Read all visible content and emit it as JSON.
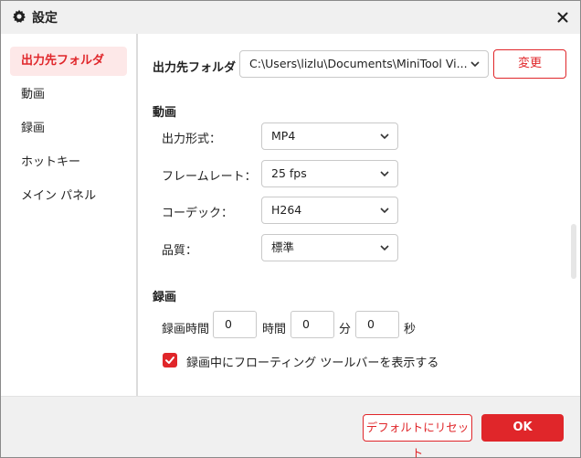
{
  "window": {
    "title": "設定",
    "icons": {
      "title": "gear-icon",
      "close": "close-icon"
    }
  },
  "sidebar": {
    "items": [
      {
        "label": "出力先フォルダ",
        "active": true
      },
      {
        "label": "動画",
        "active": false
      },
      {
        "label": "録画",
        "active": false
      },
      {
        "label": "ホットキー",
        "active": false
      },
      {
        "label": "メイン パネル",
        "active": false
      }
    ]
  },
  "output_folder": {
    "label": "出力先フォルダ",
    "path": "C:\\Users\\lizlu\\Documents\\MiniTool Vi...",
    "change_button": "変更"
  },
  "video": {
    "heading": "動画",
    "format_label": "出力形式：",
    "format_value": "MP4",
    "framerate_label": "フレームレート：",
    "framerate_value": "25 fps",
    "codec_label": "コーデック：",
    "codec_value": "H264",
    "quality_label": "品質：",
    "quality_value": "標準"
  },
  "recording": {
    "heading": "録画",
    "duration_label": "録画時間",
    "hours_value": "0",
    "hours_unit": "時間",
    "minutes_value": "0",
    "minutes_unit": "分",
    "seconds_value": "0",
    "seconds_unit": "秒",
    "floating_toolbar_label": "録画中にフローティング ツールバーを表示する",
    "floating_toolbar_checked": true
  },
  "footer": {
    "reset_button": "デフォルトにリセット",
    "ok_button": "OK"
  },
  "colors": {
    "accent": "#e0262a",
    "active_nav_bg": "#fde8e8",
    "window_bg": "#f0f0f0"
  }
}
